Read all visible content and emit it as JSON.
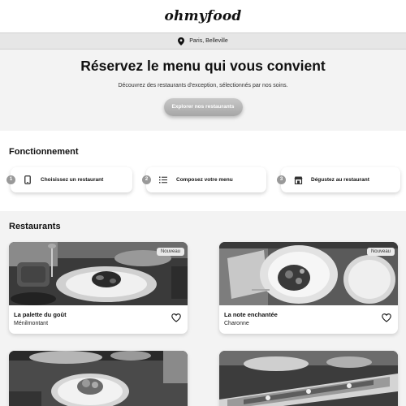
{
  "header": {
    "logo": "ohmyfood"
  },
  "location": {
    "icon": "map-pin-icon",
    "text": "Paris, Belleville"
  },
  "hero": {
    "title": "Réservez le menu qui vous convient",
    "subtitle": "Découvrez des restaurants d'exception, sélectionnés par nos soins.",
    "cta_label": "Explorer nos restaurants"
  },
  "how": {
    "title": "Fonctionnement",
    "steps": [
      {
        "num": "1",
        "icon": "smartphone-icon",
        "label": "Choisissez un restaurant"
      },
      {
        "num": "2",
        "icon": "list-icon",
        "label": "Composez votre menu"
      },
      {
        "num": "3",
        "icon": "store-icon",
        "label": "Dégustez au restaurant"
      }
    ]
  },
  "restaurants": {
    "title": "Restaurants",
    "cards": [
      {
        "name": "La palette du goût",
        "location": "Ménilmontant",
        "badge": "Nouveau"
      },
      {
        "name": "La note enchantée",
        "location": "Charonne",
        "badge": "Nouveau"
      },
      {
        "name": "",
        "location": "",
        "badge": ""
      },
      {
        "name": "",
        "location": "",
        "badge": ""
      }
    ]
  }
}
